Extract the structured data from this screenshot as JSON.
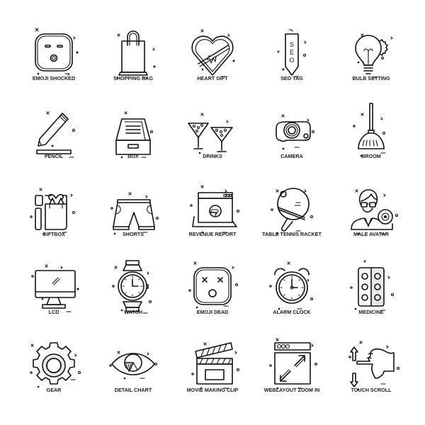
{
  "icons": [
    {
      "label": "EMOJI SHOCKED",
      "icon": "emoji-shocked-icon"
    },
    {
      "label": "SHOPPING BAG",
      "icon": "shopping-bag-icon"
    },
    {
      "label": "HEART GIFT",
      "icon": "heart-gift-icon"
    },
    {
      "label": "SEO TAG",
      "icon": "seo-tag-icon",
      "tag_text": [
        "S",
        "E",
        "O"
      ]
    },
    {
      "label": "BULB SETTING",
      "icon": "bulb-setting-icon"
    },
    {
      "label": "PENCIL",
      "icon": "pencil-icon"
    },
    {
      "label": "BOX",
      "icon": "box-icon"
    },
    {
      "label": "DRINKS",
      "icon": "drinks-icon"
    },
    {
      "label": "CAMERA",
      "icon": "camera-icon"
    },
    {
      "label": "BROOM",
      "icon": "broom-icon"
    },
    {
      "label": "GIFTBOX",
      "icon": "giftbox-icon"
    },
    {
      "label": "SHORTS",
      "icon": "shorts-icon"
    },
    {
      "label": "REVENUE REPORT",
      "icon": "revenue-report-icon"
    },
    {
      "label": "TABLE TENNIS RACKET",
      "icon": "table-tennis-racket-icon"
    },
    {
      "label": "MALE AVATAR",
      "icon": "male-avatar-icon"
    },
    {
      "label": "LCD",
      "icon": "lcd-icon"
    },
    {
      "label": "WATCH",
      "icon": "watch-icon"
    },
    {
      "label": "EMOJI DEAD",
      "icon": "emoji-dead-icon"
    },
    {
      "label": "ALARM CLOCK",
      "icon": "alarm-clock-icon"
    },
    {
      "label": "MEDICINE",
      "icon": "medicine-icon"
    },
    {
      "label": "GEAR",
      "icon": "gear-icon"
    },
    {
      "label": "DETAIL CHART",
      "icon": "detail-chart-icon"
    },
    {
      "label": "MOVIE MAKING CLIP",
      "icon": "movie-making-clip-icon"
    },
    {
      "label": "WEBLAYOUT ZOOM IN",
      "icon": "weblayout-zoom-in-icon"
    },
    {
      "label": "TOUCH SCROLL",
      "icon": "touch-scroll-icon"
    }
  ]
}
